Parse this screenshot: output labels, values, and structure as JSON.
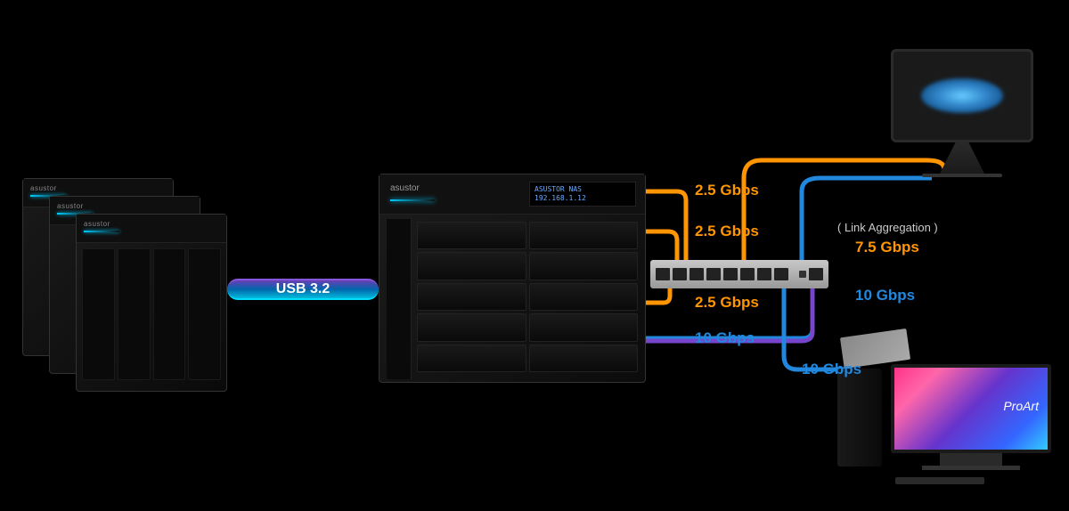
{
  "devices": {
    "expansion": {
      "brand": "asustor"
    },
    "main_nas": {
      "brand": "asustor",
      "lcd_line1": "ASUSTOR NAS",
      "lcd_line2": "192.168.1.12"
    },
    "monitor_brand": "ProArt"
  },
  "connections": {
    "usb": {
      "label": "USB 3.2",
      "color": "#00bbdd"
    },
    "link1": {
      "label": "2.5 Gbps",
      "color": "#ff9500"
    },
    "link2": {
      "label": "2.5 Gbps",
      "color": "#ff9500"
    },
    "link3": {
      "label": "2.5 Gbps",
      "color": "#ff9500"
    },
    "link4": {
      "label": "10 Gbps",
      "color": "#2288dd"
    },
    "aggregation_note": "( Link Aggregation )",
    "aggregated": {
      "label": "7.5 Gbps",
      "color": "#ff9500"
    },
    "to_imac": {
      "label": "10 Gbps",
      "color": "#2288dd"
    },
    "to_proart": {
      "label": "10 Gbps",
      "color": "#2288dd"
    }
  }
}
